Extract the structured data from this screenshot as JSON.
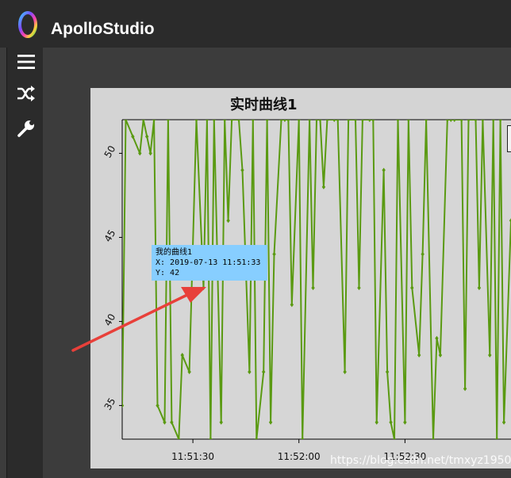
{
  "app": {
    "title": "ApolloStudio"
  },
  "sidebar": {
    "items": [
      {
        "icon": "menu-icon"
      },
      {
        "icon": "shuffle-icon"
      },
      {
        "icon": "wrench-icon"
      }
    ]
  },
  "tooltip": {
    "series_name": "我的曲线1",
    "x_text": "X: 2019-07-13 11:51:33",
    "y_text": "Y: 42"
  },
  "watermark": "https://blog.csdn.net/tmxyz1950",
  "colors": {
    "topbar": "#2b2b2b",
    "content_bg": "#3c3c3c",
    "plot_bg": "#d4d4d4",
    "line": "#5a9a12",
    "tooltip_bg": "#87ceff",
    "arrow": "#e8403a"
  },
  "chart_data": {
    "type": "line",
    "title": "实时曲线1",
    "xlabel": "",
    "ylabel": "",
    "x_ticks": [
      "11:51:30",
      "11:52:00",
      "11:52:30"
    ],
    "y_ticks": [
      35,
      40,
      45,
      50
    ],
    "xlim": [
      "11:51:10",
      "11:53:00"
    ],
    "ylim": [
      33,
      52
    ],
    "grid": true,
    "series": [
      {
        "x": [
          "11:51:10",
          "11:51:11",
          "11:51:13",
          "11:51:15",
          "11:51:16",
          "11:51:17",
          "11:51:18",
          "11:51:19",
          "11:51:20",
          "11:51:22",
          "11:51:23",
          "11:51:24",
          "11:51:26",
          "11:51:27",
          "11:51:29",
          "11:51:31",
          "11:51:33",
          "11:51:34",
          "11:51:35",
          "11:51:36",
          "11:51:38",
          "11:51:39",
          "11:51:40",
          "11:51:41",
          "11:51:43",
          "11:51:44",
          "11:51:46",
          "11:51:47",
          "11:51:48",
          "11:51:50",
          "11:51:51",
          "11:51:52",
          "11:51:53",
          "11:51:55",
          "11:51:56",
          "11:51:57",
          "11:51:58",
          "11:52:00",
          "11:52:01",
          "11:52:03",
          "11:52:04",
          "11:52:05",
          "11:52:06",
          "11:52:07",
          "11:52:08",
          "11:52:10",
          "11:52:11",
          "11:52:13",
          "11:52:14",
          "11:52:16",
          "11:52:17",
          "11:52:18",
          "11:52:20",
          "11:52:21",
          "11:52:22",
          "11:52:24",
          "11:52:25",
          "11:52:26",
          "11:52:27",
          "11:52:28",
          "11:52:30",
          "11:52:31",
          "11:52:32",
          "11:52:34",
          "11:52:35",
          "11:52:36",
          "11:52:38",
          "11:52:39",
          "11:52:40",
          "11:52:42",
          "11:52:43",
          "11:52:44",
          "11:52:46",
          "11:52:47",
          "11:52:48",
          "11:52:50",
          "11:52:51",
          "11:52:52",
          "11:52:54",
          "11:52:55",
          "11:52:56",
          "11:52:57",
          "11:52:58",
          "11:53:00"
        ],
        "y": [
          35,
          52,
          51,
          50,
          52,
          51,
          50,
          52,
          35,
          34,
          52,
          34,
          33,
          38,
          37,
          52,
          42,
          52,
          33,
          52,
          34,
          52,
          46,
          52,
          52,
          49,
          37,
          52,
          33,
          37,
          52,
          34,
          44,
          52,
          52,
          52,
          41,
          52,
          33,
          52,
          42,
          52,
          52,
          48,
          52,
          52,
          52,
          37,
          52,
          52,
          42,
          52,
          52,
          52,
          34,
          49,
          37,
          34,
          33,
          52,
          34,
          52,
          42,
          38,
          44,
          52,
          33,
          39,
          38,
          52,
          52,
          52,
          52,
          36,
          52,
          52,
          42,
          52,
          38,
          52,
          33,
          52,
          34,
          46
        ]
      }
    ]
  }
}
